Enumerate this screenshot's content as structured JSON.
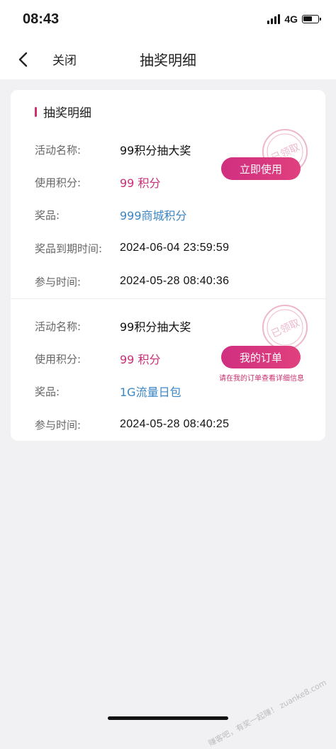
{
  "status_bar": {
    "time": "08:43",
    "network": "4G",
    "icons": [
      "signal-icon",
      "battery-icon"
    ]
  },
  "nav": {
    "back_icon": "chevron-left-icon",
    "close_label": "关闭",
    "title": "抽奖明细"
  },
  "section": {
    "title": "抽奖明细",
    "accent_color": "#d0306f"
  },
  "records": [
    {
      "activity_label": "活动名称:",
      "activity_value": "99积分抽大奖",
      "points_label": "使用积分:",
      "points_value": "99 积分",
      "prize_label": "奖品:",
      "prize_value": "999商城积分",
      "expiry_label": "奖品到期时间:",
      "expiry_value": "2024-06-04 23:59:59",
      "join_label": "参与时间:",
      "join_value": "2024-05-28 08:40:36",
      "action_label": "立即使用",
      "stamp_text": "已领取"
    },
    {
      "activity_label": "活动名称:",
      "activity_value": "99积分抽大奖",
      "points_label": "使用积分:",
      "points_value": "99 积分",
      "prize_label": "奖品:",
      "prize_value": "1G流量日包",
      "join_label": "参与时间:",
      "join_value": "2024-05-28 08:40:25",
      "action_label": "我的订单",
      "hint": "请在我的订单查看详细信息",
      "stamp_text": "已领取"
    }
  ],
  "colors": {
    "pink": "#c83078",
    "blue": "#3b86c4",
    "button_gradient_start": "#cf2f7f",
    "button_gradient_end": "#e0407e",
    "background": "#f1f1f3"
  },
  "watermark": "赚客吧，有奖一起赚！ zuanke8.com"
}
